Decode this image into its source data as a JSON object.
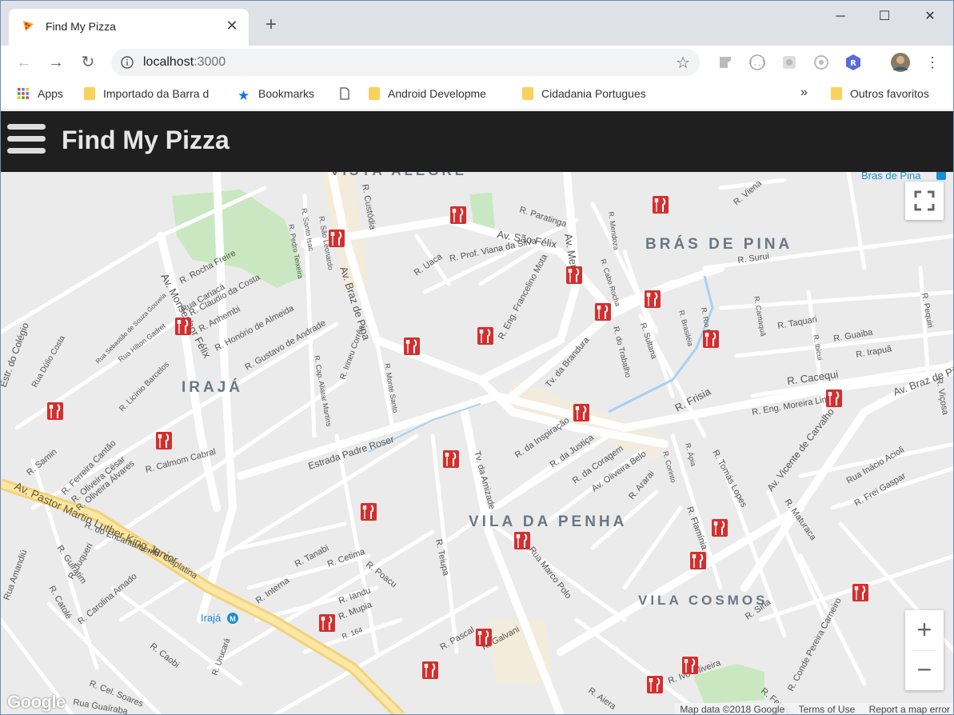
{
  "browser": {
    "tab_title": "Find My Pizza",
    "url_host": "localhost",
    "url_port": ":3000",
    "bookmarks": [
      {
        "label": "Apps",
        "icon": "apps-grid-icon"
      },
      {
        "label": "Importado da Barra d",
        "icon": "folder-icon"
      },
      {
        "label": "Bookmarks",
        "icon": "star-icon"
      },
      {
        "label": "",
        "icon": "page-icon"
      },
      {
        "label": "Android Developme",
        "icon": "folder-icon"
      },
      {
        "label": "Cidadania Portugues",
        "icon": "folder-icon"
      }
    ],
    "bookmarks_more": "»",
    "other_bookmarks": "Outros favoritos"
  },
  "app": {
    "title": "Find My Pizza"
  },
  "map": {
    "neighborhoods": [
      "VISTA ALEGRE",
      "BRÁS DE PINA",
      "IRAJÁ",
      "VILA DA PENHA",
      "VILA COSMOS"
    ],
    "streets": [
      "R. Paratinga",
      "Av. São Félix",
      "R. Custódia",
      "R. Santo Isac",
      "R. São Leonardo",
      "R. Pedro Teixeira",
      "Av. Braz de Pina",
      "R. Uaca",
      "R. Prof. Viana da Silva",
      "R. Eng. Francelino Mota",
      "Av. Meriti",
      "R. Mendoza",
      "R. Cabo Rocha",
      "R. Surui",
      "R. Viena",
      "R. Camaquã",
      "R. Taquari",
      "R. Guaiba",
      "R. Irapuã",
      "R. Pequiri",
      "R. Cacequi",
      "Av. Braz de Pina",
      "R. Eng. Moreira Lima",
      "R. Frisia",
      "R. Sultana",
      "R. Brasiléia",
      "R. Rio Pa",
      "R. Ibicui",
      "R. do Trabalho",
      "Tv. da Brandura",
      "Estrada Padre Roser",
      "R. Irineu Corrêa",
      "R. Monte Santo",
      "R. Cap. Aliatar Martins",
      "R. Gustavo de Andrade",
      "R. Honório de Almeida",
      "R. Anhembi",
      "R. Cláudio da Costa",
      "Rua Cariacá",
      "R. Rocha Freire",
      "Av. Monsenhor Félix",
      "Rua Hilton Gadret",
      "R. Licínio Barcelos",
      "Rua Sebastião de Souza Gouveia",
      "Rua Dúlio Costa",
      "Estr. do Colégio",
      "R. Samin",
      "R. Ferreira Cantão",
      "R. Oliveira César",
      "R. Oliveira Álvares",
      "R. Calmom Cabral",
      "Av. Pastor Martin Luther King Junior",
      "R. do Encantamento",
      "R. Cisplatina",
      "R. Guiratim",
      "R. Juqueri",
      "R. Catolé",
      "Rua Amandiú",
      "R. Carolina Amado",
      "R. Caobi",
      "R. Cel. Soares",
      "Rua Guaíraba",
      "R. Urucará",
      "R. Interna",
      "R. Tanabi",
      "R. Cetima",
      "R. Poacu",
      "R. Iandu",
      "R. Mupia",
      "R. 164",
      "R. Teiupa",
      "R. Pascal",
      "R. Galvani",
      "Rua Marco Polo",
      "Tv. da Amizade",
      "R. da Inspiração",
      "R. da Justiça",
      "R. da Coragem",
      "Av. Oliveira Belo",
      "R. Corinto",
      "R. Ápia",
      "R. Tomás Lopes",
      "Av. Vicente de Carvalho",
      "Rua Inácio Acioli",
      "R. Frei Gaspar",
      "R. Maturaca",
      "R. Flamínia",
      "R. Siria",
      "R. Conde Pereira Carneiro",
      "R. Ferreira",
      "R. Aiera",
      "R. Ivo Oliveira",
      "R. Viçosa",
      "R. Ararai"
    ],
    "metro_label": "Irajá",
    "transit_label": "Bras de Pina",
    "footer": {
      "map_data": "Map data ©2018 Google",
      "terms": "Terms of Use",
      "report": "Report a map error"
    },
    "logo": "Google",
    "zoom_in": "+",
    "zoom_out": "−",
    "marker_icon": "restaurant-fork-knife-icon",
    "marker_color": "#d32f2f"
  }
}
